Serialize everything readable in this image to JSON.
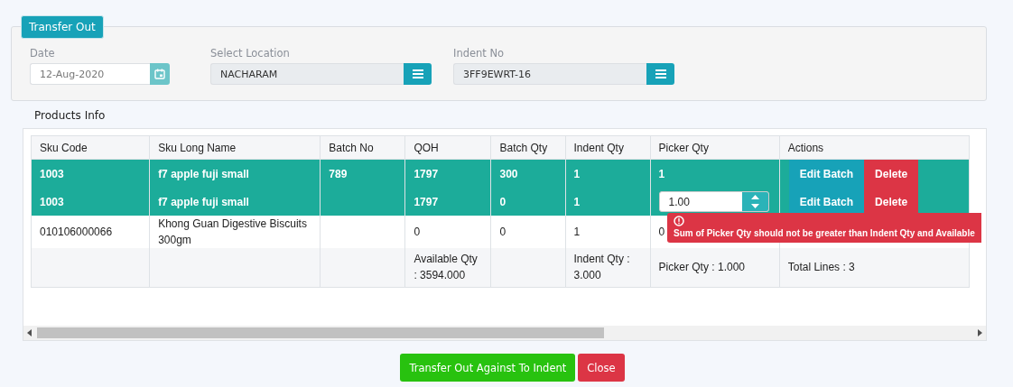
{
  "panel": {
    "legend": "Transfer Out",
    "fields": [
      {
        "kind": "date",
        "label": "Date",
        "value": "12-Aug-2020"
      },
      {
        "kind": "select",
        "label": "Select Location",
        "value": "NACHARAM"
      },
      {
        "kind": "select",
        "label": "Indent No",
        "value": "3FF9EWRT-16"
      }
    ]
  },
  "section_title": "Products Info",
  "table": {
    "columns": [
      "Sku Code",
      "Sku Long Name",
      "Batch No",
      "QOH",
      "Batch Qty",
      "Indent Qty",
      "Picker Qty",
      "Actions"
    ],
    "rows": [
      {
        "selected": true,
        "sku_code": "1003",
        "name": "f7 apple fuji small",
        "batch_no": "789",
        "qoh": "1797",
        "batch_qty": "300",
        "indent_qty": "1",
        "picker": {
          "kind": "text",
          "value": "1"
        },
        "actions": [
          "Edit Batch",
          "Delete"
        ]
      },
      {
        "selected": true,
        "sku_code": "1003",
        "name": "f7 apple fuji small",
        "qoh": "1797",
        "batch_qty": "0",
        "indent_qty": "1",
        "picker": {
          "kind": "spinner",
          "value": "1.00"
        },
        "actions": [
          "Edit Batch",
          "Delete"
        ],
        "error": "Sum of Picker Qty should not be greater than Indent Qty and Available"
      },
      {
        "selected": false,
        "sku_code": "010106000066",
        "name": "Khong Guan Digestive Biscuits 300gm",
        "qoh": "0",
        "batch_qty": "0",
        "indent_qty": "1",
        "picker": {
          "kind": "text",
          "value": "0"
        }
      }
    ],
    "footer": {
      "qoh": "Available Qty : 3594.000",
      "indent_qty": "Indent Qty : 3.000",
      "picker_qty": "Picker Qty : 1.000",
      "actions": "Total Lines : 3"
    }
  },
  "buttons": [
    {
      "kind": "primary",
      "label": "Transfer Out Against To Indent"
    },
    {
      "kind": "danger",
      "label": "Close"
    }
  ]
}
